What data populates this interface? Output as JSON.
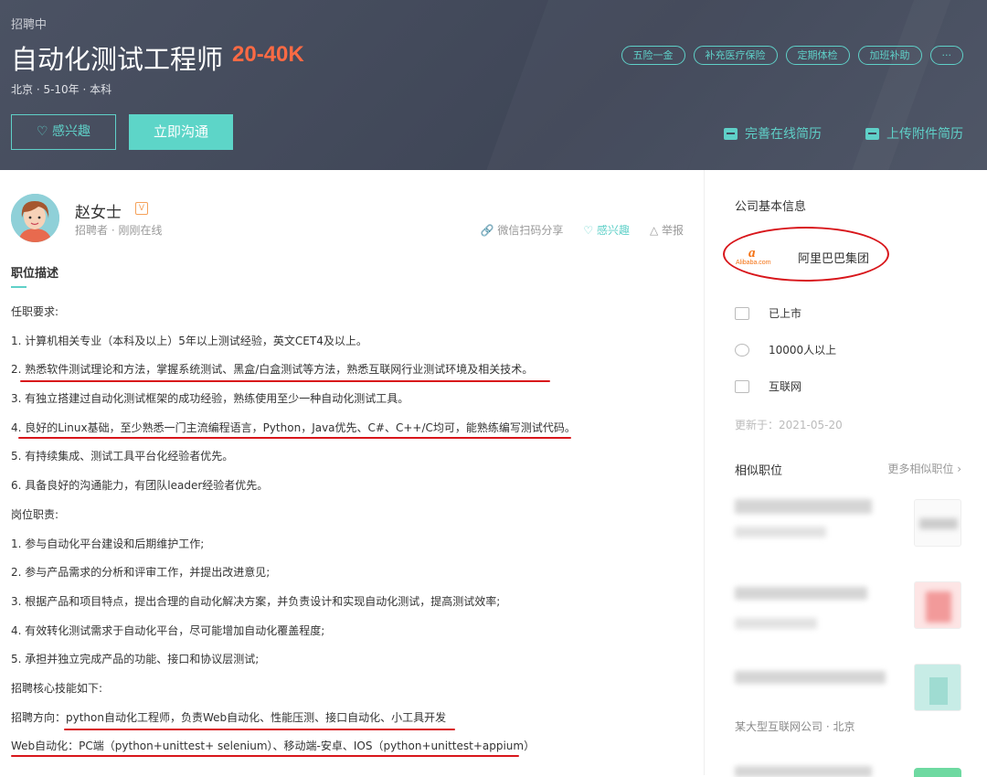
{
  "header": {
    "status": "招聘中",
    "title": "自动化测试工程师",
    "salary": "20-40K",
    "meta": "北京 · 5-10年 · 本科",
    "tags": [
      "五险一金",
      "补充医疗保险",
      "定期体检",
      "加班补助",
      "···"
    ],
    "fav_label": "♡ 感兴趣",
    "chat_label": "立即沟通",
    "online_resume": "完善在线简历",
    "upload_resume": "上传附件简历"
  },
  "recruiter": {
    "name": "赵女士",
    "badge": "V",
    "role": "招聘者 · 刚刚在线",
    "share": "微信扫码分享",
    "interest": "♡ 感兴趣",
    "report": "△ 举报"
  },
  "job": {
    "section_title": "职位描述",
    "lines": [
      "任职要求:",
      "1. 计算机相关专业（本科及以上）5年以上测试经验，英文CET4及以上。",
      "2. 熟悉软件测试理论和方法，掌握系统测试、黑盒/白盒测试等方法，熟悉互联网行业测试环境及相关技术。",
      "3. 有独立搭建过自动化测试框架的成功经验，熟练使用至少一种自动化测试工具。",
      "4. 良好的Linux基础，至少熟悉一门主流编程语言，Python，Java优先、C#、C++/C均可，能熟练编写测试代码。",
      "5. 有持续集成、测试工具平台化经验者优先。",
      "6. 具备良好的沟通能力，有团队leader经验者优先。",
      "岗位职责:",
      "1. 参与自动化平台建设和后期维护工作;",
      "2. 参与产品需求的分析和评审工作，并提出改进意见;",
      "3. 根据产品和项目特点，提出合理的自动化解决方案，并负责设计和实现自动化测试，提高测试效率;",
      "4. 有效转化测试需求于自动化平台，尽可能增加自动化覆盖程度;",
      "5. 承担并独立完成产品的功能、接口和协议层测试;",
      "招聘核心技能如下:",
      "招聘方向：python自动化工程师，负责Web自动化、性能压测、接口自动化、小工具开发",
      "Web自动化：PC端（python+unittest+ selenium）、移动端-安卓、IOS（python+unittest+appium）"
    ]
  },
  "company": {
    "section_title": "公司基本信息",
    "logo_text": "Alibaba.com",
    "name": "阿里巴巴集团",
    "stage": "已上市",
    "size": "10000人以上",
    "industry": "互联网",
    "updated": "更新于：2021-05-20"
  },
  "similar": {
    "title": "相似职位",
    "more": "更多相似职位 ›",
    "company_meta": "某大型互联网公司 · 北京"
  },
  "colors": {
    "accent": "#5dd5c8",
    "salary": "#fd6a44",
    "annotation_red": "#d8161b"
  }
}
